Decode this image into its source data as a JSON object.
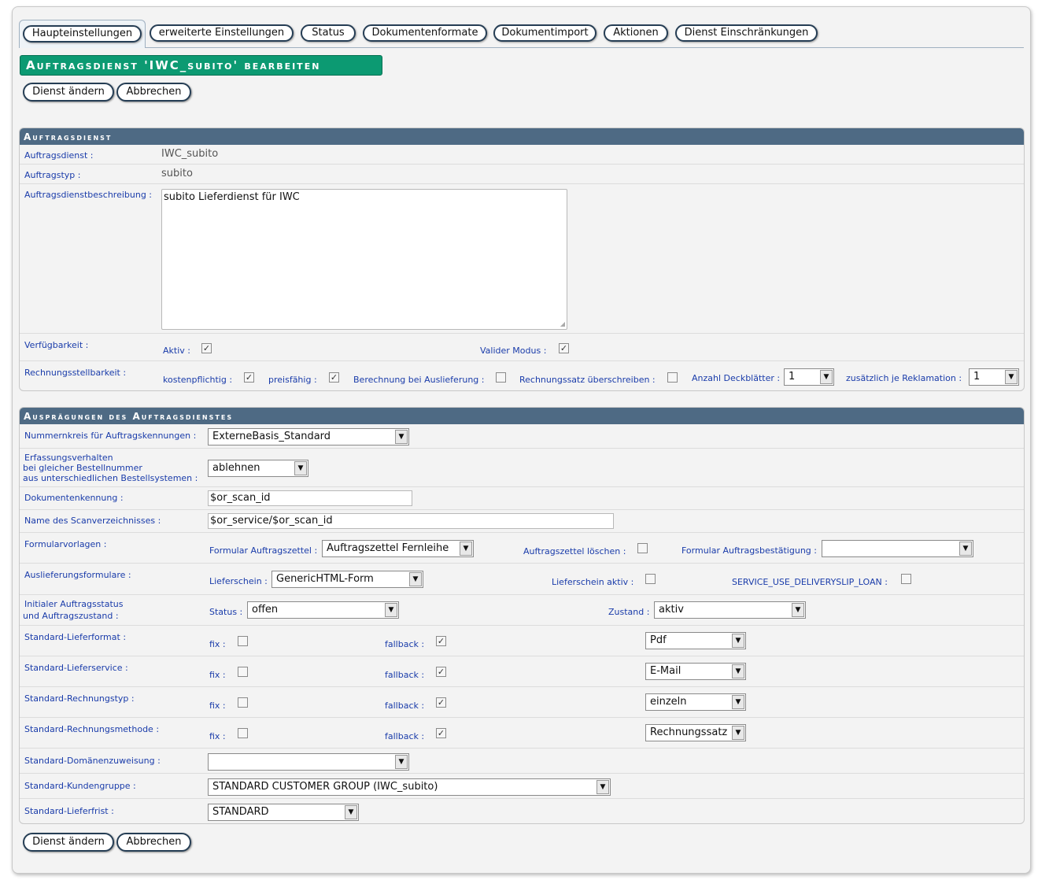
{
  "tabs": [
    "Haupteinstellungen",
    "erweiterte Einstellungen",
    "Status",
    "Dokumentenformate",
    "Dokumentimport",
    "Aktionen",
    "Dienst Einschränkungen"
  ],
  "title": "Auftragsdienst 'IWC_subito' bearbeiten",
  "buttons": {
    "save": "Dienst ändern",
    "cancel": "Abbrechen"
  },
  "section1": {
    "header": "Auftragsdienst",
    "auftragsdienst_label": "Auftragsdienst :",
    "auftragsdienst_value": "IWC_subito",
    "auftragstyp_label": "Auftragstyp :",
    "auftragstyp_value": "subito",
    "beschreibung_label": "Auftragsdienstbeschreibung :",
    "beschreibung_value": "subito Lieferdienst für IWC",
    "verfuegbarkeit_label": "Verfügbarkeit :",
    "aktiv_label": "Aktiv :",
    "aktiv_checked": true,
    "valider_label": "Valider Modus :",
    "valider_checked": true,
    "rechnung_label": "Rechnungsstellbarkeit :",
    "kostenpflichtig_label": "kostenpflichtig :",
    "kostenpflichtig_checked": true,
    "preisfaehig_label": "preisfähig :",
    "preisfaehig_checked": true,
    "berechnung_label": "Berechnung bei Auslieferung :",
    "berechnung_checked": false,
    "rechnungssatz_label": "Rechnungssatz überschreiben :",
    "rechnungssatz_checked": false,
    "deckblaetter_label": "Anzahl Deckblätter :",
    "deckblaetter_value": "1",
    "reklamation_label": "zusätzlich je Reklamation :",
    "reklamation_value": "1"
  },
  "section2": {
    "header": "Ausprägungen des Auftragsdienstes",
    "nummernkreis_label": "Nummernkreis für Auftragskennungen :",
    "nummernkreis_value": "ExterneBasis_Standard",
    "erfassung_label_1": "Erfassungsverhalten",
    "erfassung_label_2": "bei gleicher Bestellnummer",
    "erfassung_label_3": "aus unterschiedlichen Bestellsystemen :",
    "erfassung_value": "ablehnen",
    "dokumentenkennung_label": "Dokumentenkennung :",
    "dokumentenkennung_value": "$or_scan_id",
    "scanverz_label": "Name des Scanverzeichnisses :",
    "scanverz_value": "$or_service/$or_scan_id",
    "formular_label": "Formularvorlagen :",
    "formular_auftragszettel_label": "Formular Auftragszettel :",
    "formular_auftragszettel_value": "Auftragszettel Fernleihe",
    "auftragszettel_loeschen_label": "Auftragszettel löschen :",
    "auftragszettel_loeschen_checked": false,
    "formular_bestaetigung_label": "Formular Auftragsbestätigung :",
    "formular_bestaetigung_value": "",
    "auslieferung_label": "Auslieferungsformulare :",
    "lieferschein_label": "Lieferschein :",
    "lieferschein_value": "GenericHTML-Form",
    "lieferschein_aktiv_label": "Lieferschein aktiv :",
    "lieferschein_aktiv_checked": false,
    "deliveryslip_label": "SERVICE_USE_DELIVERYSLIP_LOAN :",
    "deliveryslip_checked": false,
    "initial_label_1": "Initialer Auftragsstatus",
    "initial_label_2": "und Auftragszustand :",
    "status_label": "Status :",
    "status_value": "offen",
    "zustand_label": "Zustand :",
    "zustand_value": "aktiv",
    "defaults": [
      {
        "label": "Standard-Lieferformat :",
        "fix": false,
        "fallback": true,
        "value": "Pdf"
      },
      {
        "label": "Standard-Lieferservice :",
        "fix": false,
        "fallback": true,
        "value": "E-Mail"
      },
      {
        "label": "Standard-Rechnungstyp :",
        "fix": false,
        "fallback": true,
        "value": "einzeln"
      },
      {
        "label": "Standard-Rechnungsmethode :",
        "fix": false,
        "fallback": true,
        "value": "Rechnungssatz"
      }
    ],
    "fix_label": "fix :",
    "fallback_label": "fallback :",
    "domaenen_label": "Standard-Domänenzuweisung :",
    "domaenen_value": "",
    "kundengruppe_label": "Standard-Kundengruppe :",
    "kundengruppe_value": "STANDARD CUSTOMER GROUP (IWC_subito)",
    "lieferfrist_label": "Standard-Lieferfrist :",
    "lieferfrist_value": "STANDARD"
  }
}
